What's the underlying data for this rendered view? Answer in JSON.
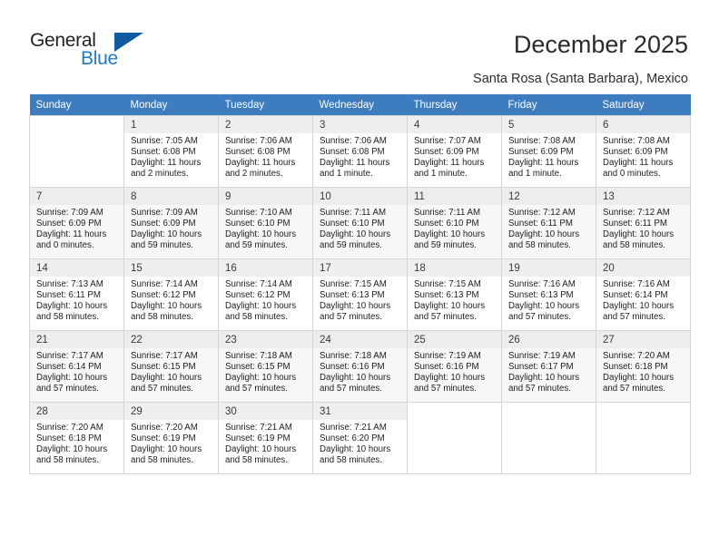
{
  "brand": {
    "name_part1": "General",
    "name_part2": "Blue",
    "triangle_icon": "triangle-icon",
    "color_dark": "#231f20",
    "color_blue": "#1c7cc4"
  },
  "header": {
    "title": "December 2025",
    "subtitle": "Santa Rosa (Santa Barbara), Mexico",
    "header_bg": "#3d7cbe"
  },
  "weekdays": [
    "Sunday",
    "Monday",
    "Tuesday",
    "Wednesday",
    "Thursday",
    "Friday",
    "Saturday"
  ],
  "labels": {
    "sunrise": "Sunrise:",
    "sunset": "Sunset:",
    "daylight": "Daylight:"
  },
  "weeks": [
    {
      "shaded": false,
      "days": [
        {
          "empty": true
        },
        {
          "num": "1",
          "sunrise": "Sunrise: 7:05 AM",
          "sunset": "Sunset: 6:08 PM",
          "daylight_line1": "Daylight: 11 hours",
          "daylight_line2": "and 2 minutes."
        },
        {
          "num": "2",
          "sunrise": "Sunrise: 7:06 AM",
          "sunset": "Sunset: 6:08 PM",
          "daylight_line1": "Daylight: 11 hours",
          "daylight_line2": "and 2 minutes."
        },
        {
          "num": "3",
          "sunrise": "Sunrise: 7:06 AM",
          "sunset": "Sunset: 6:08 PM",
          "daylight_line1": "Daylight: 11 hours",
          "daylight_line2": "and 1 minute."
        },
        {
          "num": "4",
          "sunrise": "Sunrise: 7:07 AM",
          "sunset": "Sunset: 6:09 PM",
          "daylight_line1": "Daylight: 11 hours",
          "daylight_line2": "and 1 minute."
        },
        {
          "num": "5",
          "sunrise": "Sunrise: 7:08 AM",
          "sunset": "Sunset: 6:09 PM",
          "daylight_line1": "Daylight: 11 hours",
          "daylight_line2": "and 1 minute."
        },
        {
          "num": "6",
          "sunrise": "Sunrise: 7:08 AM",
          "sunset": "Sunset: 6:09 PM",
          "daylight_line1": "Daylight: 11 hours",
          "daylight_line2": "and 0 minutes."
        }
      ]
    },
    {
      "shaded": true,
      "days": [
        {
          "num": "7",
          "sunrise": "Sunrise: 7:09 AM",
          "sunset": "Sunset: 6:09 PM",
          "daylight_line1": "Daylight: 11 hours",
          "daylight_line2": "and 0 minutes."
        },
        {
          "num": "8",
          "sunrise": "Sunrise: 7:09 AM",
          "sunset": "Sunset: 6:09 PM",
          "daylight_line1": "Daylight: 10 hours",
          "daylight_line2": "and 59 minutes."
        },
        {
          "num": "9",
          "sunrise": "Sunrise: 7:10 AM",
          "sunset": "Sunset: 6:10 PM",
          "daylight_line1": "Daylight: 10 hours",
          "daylight_line2": "and 59 minutes."
        },
        {
          "num": "10",
          "sunrise": "Sunrise: 7:11 AM",
          "sunset": "Sunset: 6:10 PM",
          "daylight_line1": "Daylight: 10 hours",
          "daylight_line2": "and 59 minutes."
        },
        {
          "num": "11",
          "sunrise": "Sunrise: 7:11 AM",
          "sunset": "Sunset: 6:10 PM",
          "daylight_line1": "Daylight: 10 hours",
          "daylight_line2": "and 59 minutes."
        },
        {
          "num": "12",
          "sunrise": "Sunrise: 7:12 AM",
          "sunset": "Sunset: 6:11 PM",
          "daylight_line1": "Daylight: 10 hours",
          "daylight_line2": "and 58 minutes."
        },
        {
          "num": "13",
          "sunrise": "Sunrise: 7:12 AM",
          "sunset": "Sunset: 6:11 PM",
          "daylight_line1": "Daylight: 10 hours",
          "daylight_line2": "and 58 minutes."
        }
      ]
    },
    {
      "shaded": false,
      "days": [
        {
          "num": "14",
          "sunrise": "Sunrise: 7:13 AM",
          "sunset": "Sunset: 6:11 PM",
          "daylight_line1": "Daylight: 10 hours",
          "daylight_line2": "and 58 minutes."
        },
        {
          "num": "15",
          "sunrise": "Sunrise: 7:14 AM",
          "sunset": "Sunset: 6:12 PM",
          "daylight_line1": "Daylight: 10 hours",
          "daylight_line2": "and 58 minutes."
        },
        {
          "num": "16",
          "sunrise": "Sunrise: 7:14 AM",
          "sunset": "Sunset: 6:12 PM",
          "daylight_line1": "Daylight: 10 hours",
          "daylight_line2": "and 58 minutes."
        },
        {
          "num": "17",
          "sunrise": "Sunrise: 7:15 AM",
          "sunset": "Sunset: 6:13 PM",
          "daylight_line1": "Daylight: 10 hours",
          "daylight_line2": "and 57 minutes."
        },
        {
          "num": "18",
          "sunrise": "Sunrise: 7:15 AM",
          "sunset": "Sunset: 6:13 PM",
          "daylight_line1": "Daylight: 10 hours",
          "daylight_line2": "and 57 minutes."
        },
        {
          "num": "19",
          "sunrise": "Sunrise: 7:16 AM",
          "sunset": "Sunset: 6:13 PM",
          "daylight_line1": "Daylight: 10 hours",
          "daylight_line2": "and 57 minutes."
        },
        {
          "num": "20",
          "sunrise": "Sunrise: 7:16 AM",
          "sunset": "Sunset: 6:14 PM",
          "daylight_line1": "Daylight: 10 hours",
          "daylight_line2": "and 57 minutes."
        }
      ]
    },
    {
      "shaded": true,
      "days": [
        {
          "num": "21",
          "sunrise": "Sunrise: 7:17 AM",
          "sunset": "Sunset: 6:14 PM",
          "daylight_line1": "Daylight: 10 hours",
          "daylight_line2": "and 57 minutes."
        },
        {
          "num": "22",
          "sunrise": "Sunrise: 7:17 AM",
          "sunset": "Sunset: 6:15 PM",
          "daylight_line1": "Daylight: 10 hours",
          "daylight_line2": "and 57 minutes."
        },
        {
          "num": "23",
          "sunrise": "Sunrise: 7:18 AM",
          "sunset": "Sunset: 6:15 PM",
          "daylight_line1": "Daylight: 10 hours",
          "daylight_line2": "and 57 minutes."
        },
        {
          "num": "24",
          "sunrise": "Sunrise: 7:18 AM",
          "sunset": "Sunset: 6:16 PM",
          "daylight_line1": "Daylight: 10 hours",
          "daylight_line2": "and 57 minutes."
        },
        {
          "num": "25",
          "sunrise": "Sunrise: 7:19 AM",
          "sunset": "Sunset: 6:16 PM",
          "daylight_line1": "Daylight: 10 hours",
          "daylight_line2": "and 57 minutes."
        },
        {
          "num": "26",
          "sunrise": "Sunrise: 7:19 AM",
          "sunset": "Sunset: 6:17 PM",
          "daylight_line1": "Daylight: 10 hours",
          "daylight_line2": "and 57 minutes."
        },
        {
          "num": "27",
          "sunrise": "Sunrise: 7:20 AM",
          "sunset": "Sunset: 6:18 PM",
          "daylight_line1": "Daylight: 10 hours",
          "daylight_line2": "and 57 minutes."
        }
      ]
    },
    {
      "shaded": false,
      "days": [
        {
          "num": "28",
          "sunrise": "Sunrise: 7:20 AM",
          "sunset": "Sunset: 6:18 PM",
          "daylight_line1": "Daylight: 10 hours",
          "daylight_line2": "and 58 minutes."
        },
        {
          "num": "29",
          "sunrise": "Sunrise: 7:20 AM",
          "sunset": "Sunset: 6:19 PM",
          "daylight_line1": "Daylight: 10 hours",
          "daylight_line2": "and 58 minutes."
        },
        {
          "num": "30",
          "sunrise": "Sunrise: 7:21 AM",
          "sunset": "Sunset: 6:19 PM",
          "daylight_line1": "Daylight: 10 hours",
          "daylight_line2": "and 58 minutes."
        },
        {
          "num": "31",
          "sunrise": "Sunrise: 7:21 AM",
          "sunset": "Sunset: 6:20 PM",
          "daylight_line1": "Daylight: 10 hours",
          "daylight_line2": "and 58 minutes."
        },
        {
          "empty": true
        },
        {
          "empty": true
        },
        {
          "empty": true
        }
      ]
    }
  ]
}
